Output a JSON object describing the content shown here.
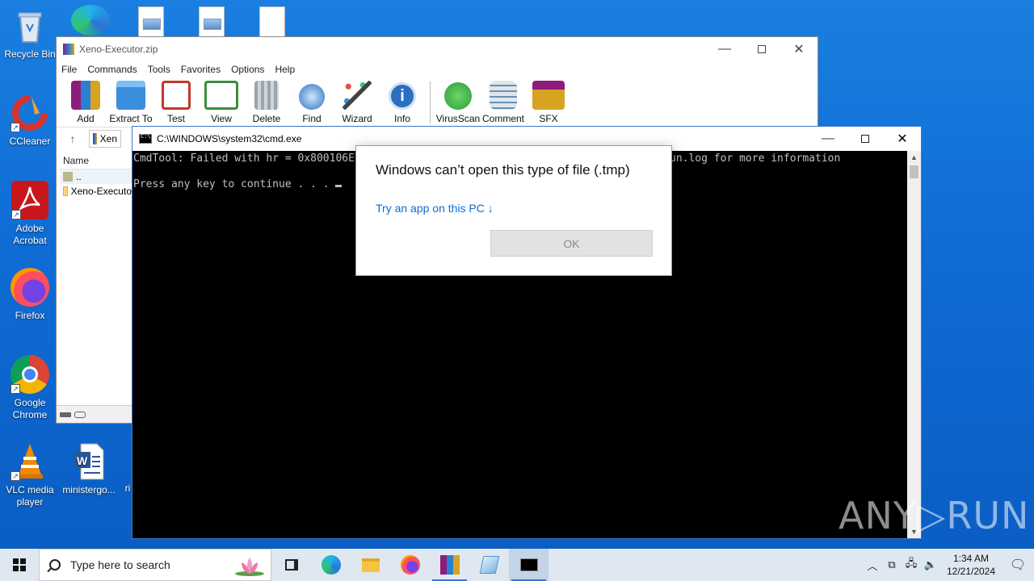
{
  "desktop": {
    "icons": [
      {
        "label": "Recycle Bin"
      },
      {
        "label": "CCleaner"
      },
      {
        "label": "Adobe Acrobat"
      },
      {
        "label": "Firefox"
      },
      {
        "label": "Google Chrome"
      },
      {
        "label": "VLC media player"
      },
      {
        "label": "ministergo..."
      },
      {
        "label": "ri"
      }
    ]
  },
  "winrar": {
    "title": "Xeno-Executor.zip",
    "menu": [
      "File",
      "Commands",
      "Tools",
      "Favorites",
      "Options",
      "Help"
    ],
    "toolbar": [
      {
        "label": "Add",
        "icon": "add-archive-icon",
        "color": "#c0392b"
      },
      {
        "label": "Extract To",
        "icon": "folder-extract-icon",
        "color": "#3b8ede"
      },
      {
        "label": "Test",
        "icon": "test-clipboard-icon",
        "color": "#c0392b"
      },
      {
        "label": "View",
        "icon": "book-view-icon",
        "color": "#3a8f3a"
      },
      {
        "label": "Delete",
        "icon": "trash-icon",
        "color": "#7f8c8d"
      },
      {
        "label": "Find",
        "icon": "magnifier-icon",
        "color": "#2a6fc0"
      },
      {
        "label": "Wizard",
        "icon": "magic-wand-icon",
        "color": "#8e44ad"
      },
      {
        "label": "Info",
        "icon": "info-icon",
        "color": "#2a6fc0"
      },
      {
        "label": "VirusScan",
        "icon": "virus-scan-icon",
        "color": "#2e9e36"
      },
      {
        "label": "Comment",
        "icon": "comment-icon",
        "color": "#6b8fb0"
      },
      {
        "label": "SFX",
        "icon": "sfx-box-icon",
        "color": "#d35400"
      }
    ],
    "address_text": "Xen",
    "column_name": "Name",
    "files": [
      {
        "name": ".."
      },
      {
        "name": "Xeno-Executo"
      }
    ]
  },
  "cmd": {
    "title": "C:\\WINDOWS\\system32\\cmd.exe",
    "line1": "CmdTool: Failed with hr = 0x800106E",
    "line1_tail": "un.log for more information",
    "line2": "Press any key to continue . . . "
  },
  "dialog": {
    "message": "Windows can’t open this type of file (.tmp)",
    "link": "Try an app on this PC ↓",
    "ok_label": "OK"
  },
  "watermark": "ANY▷RUN",
  "taskbar": {
    "search_placeholder": "Type here to search",
    "time": "1:34 AM",
    "date": "12/21/2024"
  },
  "colors": {
    "desktop": "#0f6dd6",
    "link": "#0a6fd4",
    "cmd_background": "#000000",
    "cmd_text": "#c0c0c0"
  }
}
